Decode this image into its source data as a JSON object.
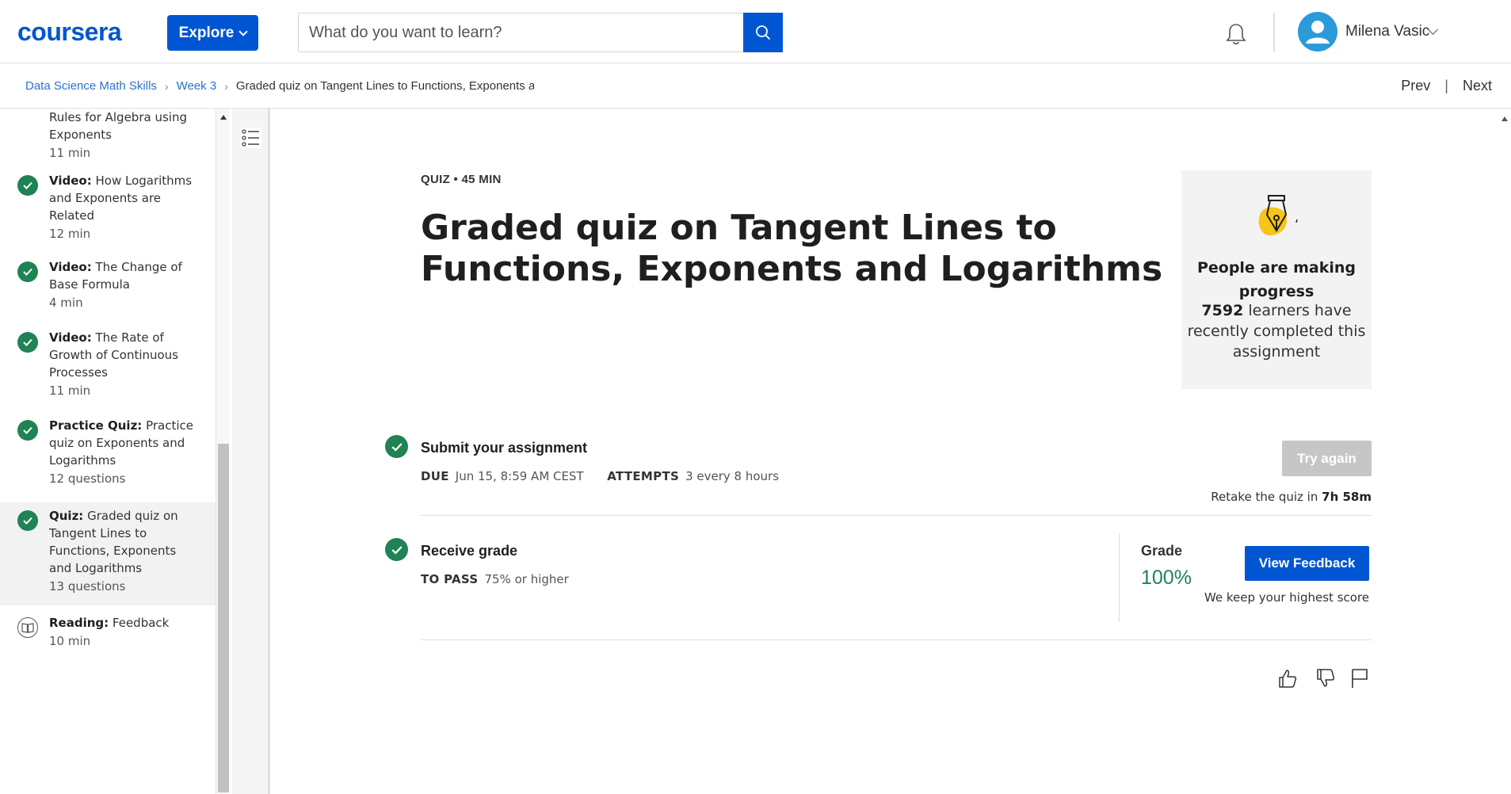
{
  "header": {
    "logo": "coursera",
    "explore_label": "Explore",
    "search_placeholder": "What do you want to learn?",
    "user_name": "Milena Vasic"
  },
  "breadcrumb": {
    "items": [
      "Data Science Math Skills",
      "Week 3",
      "Graded quiz on Tangent Lines to Functions, Exponents and Logarithms"
    ],
    "prev": "Prev",
    "next": "Next",
    "separator": "|"
  },
  "sidebar": {
    "items": [
      {
        "type": "",
        "title": "Rules for Algebra using Exponents",
        "meta": "11 min",
        "status": "partial"
      },
      {
        "type": "Video:",
        "title": "How Logarithms and Exponents are Related",
        "meta": "12 min",
        "status": "completed"
      },
      {
        "type": "Video:",
        "title": "The Change of Base Formula",
        "meta": "4 min",
        "status": "completed"
      },
      {
        "type": "Video:",
        "title": "The Rate of Growth of Continuous Processes",
        "meta": "11 min",
        "status": "completed"
      },
      {
        "type": "Practice Quiz:",
        "title": "Practice quiz on Exponents and Logarithms",
        "meta": "12 questions",
        "status": "completed"
      },
      {
        "type": "Quiz:",
        "title": "Graded quiz on Tangent Lines to Functions, Exponents and Logarithms",
        "meta": "13 questions",
        "status": "completed",
        "active": true
      },
      {
        "type": "Reading:",
        "title": "Feedback",
        "meta": "10 min",
        "status": "reading"
      }
    ]
  },
  "main": {
    "kicker": "QUIZ • 45 MIN",
    "title": "Graded quiz on Tangent Lines to Functions, Exponents and Logarithms",
    "progress_card": {
      "heading": "People are making progress",
      "count": "7592",
      "body": "learners have recently completed this assignment"
    },
    "submit": {
      "title": "Submit your assignment",
      "due_label": "DUE",
      "due_value": "Jun 15, 8:59 AM CEST",
      "attempts_label": "ATTEMPTS",
      "attempts_value": "3 every 8 hours",
      "try_again": "Try again",
      "retake_prefix": "Retake the quiz in",
      "retake_time": "7h 58m"
    },
    "grade": {
      "title": "Receive grade",
      "pass_label": "TO PASS",
      "pass_value": "75% or higher",
      "grade_label": "Grade",
      "grade_value": "100%",
      "feedback_btn": "View Feedback",
      "note": "We keep your highest score"
    }
  },
  "colors": {
    "brand_blue": "#0056d2",
    "success_green": "#1f8354",
    "link_blue": "#2a73cc",
    "disabled_gray": "#c6c6c6"
  }
}
